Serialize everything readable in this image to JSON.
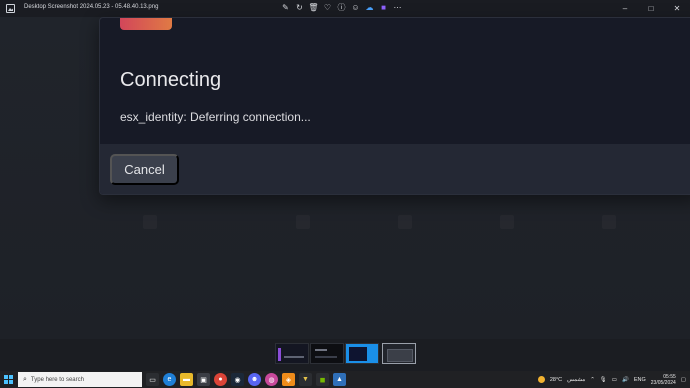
{
  "viewer": {
    "filename": "Desktop Screenshot 2024.05.23 - 05.48.40.13.png",
    "toolbar_icons": [
      "edit-icon",
      "rotate-icon",
      "delete-icon",
      "favorite-icon",
      "info-icon",
      "share-icon",
      "onedrive-icon",
      "clipchamp-icon",
      "more-icon"
    ],
    "window_controls": {
      "minimize": "–",
      "maximize": "□",
      "close": "✕"
    }
  },
  "dialog": {
    "title": "Connecting",
    "message": "esx_identity: Deferring connection...",
    "cancel_label": "Cancel",
    "accent_colors": [
      "#d2465a",
      "#e07a44"
    ]
  },
  "filmstrip": {
    "thumbnails": [
      {
        "name": "thumbnail-1",
        "active": false
      },
      {
        "name": "thumbnail-2",
        "active": false
      },
      {
        "name": "thumbnail-3",
        "active": false
      },
      {
        "name": "thumbnail-4",
        "active": true
      }
    ]
  },
  "taskbar": {
    "search_placeholder": "Type here to search",
    "pinned_apps": [
      "task-view-icon",
      "edge-icon",
      "file-explorer-icon",
      "store-icon",
      "chrome-icon",
      "steam-icon",
      "discord-icon",
      "paint-icon",
      "vpn-icon",
      "game-icon",
      "nvidia-icon",
      "photos-icon"
    ],
    "weather_temp": "28°C",
    "weather_text": "مشمس",
    "language": "ENG",
    "time": "05:55",
    "date": "23/05/2024"
  }
}
